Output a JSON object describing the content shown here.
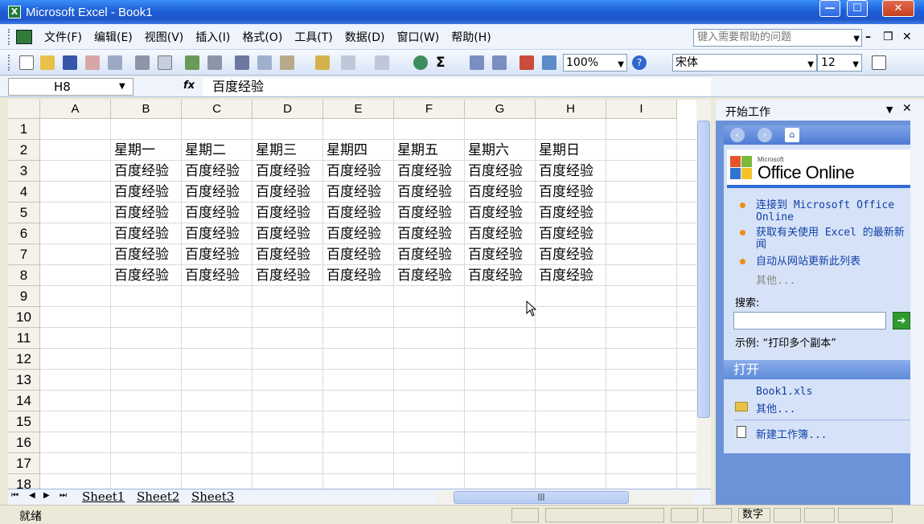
{
  "window": {
    "title": "Microsoft Excel - Book1",
    "min": "—",
    "max": "☐",
    "close": "✕"
  },
  "menu": {
    "items": [
      "文件(F)",
      "编辑(E)",
      "视图(V)",
      "插入(I)",
      "格式(O)",
      "工具(T)",
      "数据(D)",
      "窗口(W)",
      "帮助(H)"
    ],
    "help_placeholder": "键入需要帮助的问题"
  },
  "toolbar": {
    "zoom": "100%",
    "font": "宋体",
    "font_size": "12"
  },
  "formula_bar": {
    "cell_ref": "H8",
    "fx": "fx",
    "value": "百度经验"
  },
  "grid": {
    "columns": [
      "A",
      "B",
      "C",
      "D",
      "E",
      "F",
      "G",
      "H",
      "I"
    ],
    "rows": [
      "1",
      "2",
      "3",
      "4",
      "5",
      "6",
      "7",
      "8",
      "9",
      "10",
      "11",
      "12",
      "13",
      "14",
      "15",
      "16",
      "17",
      "18"
    ],
    "row2": [
      "星期一",
      "星期二",
      "星期三",
      "星期四",
      "星期五",
      "星期六",
      "星期日"
    ],
    "data_value": "百度经验"
  },
  "sheets": {
    "tabs": [
      "Sheet1",
      "Sheet2",
      "Sheet3"
    ]
  },
  "status": {
    "text": "就绪",
    "num": "数字"
  },
  "task_pane": {
    "title": "开始工作",
    "logo_small": "Microsoft",
    "logo_text": "Office Online",
    "links": [
      "连接到 Microsoft Office Online",
      "获取有关使用 Excel 的最新新闻",
      "自动从网站更新此列表"
    ],
    "more": "其他...",
    "search_label": "搜索:",
    "example": "示例: “打印多个副本”",
    "open_title": "打开",
    "recent_file": "Book1.xls",
    "open_more": "其他...",
    "new_workbook": "新建工作簿..."
  }
}
